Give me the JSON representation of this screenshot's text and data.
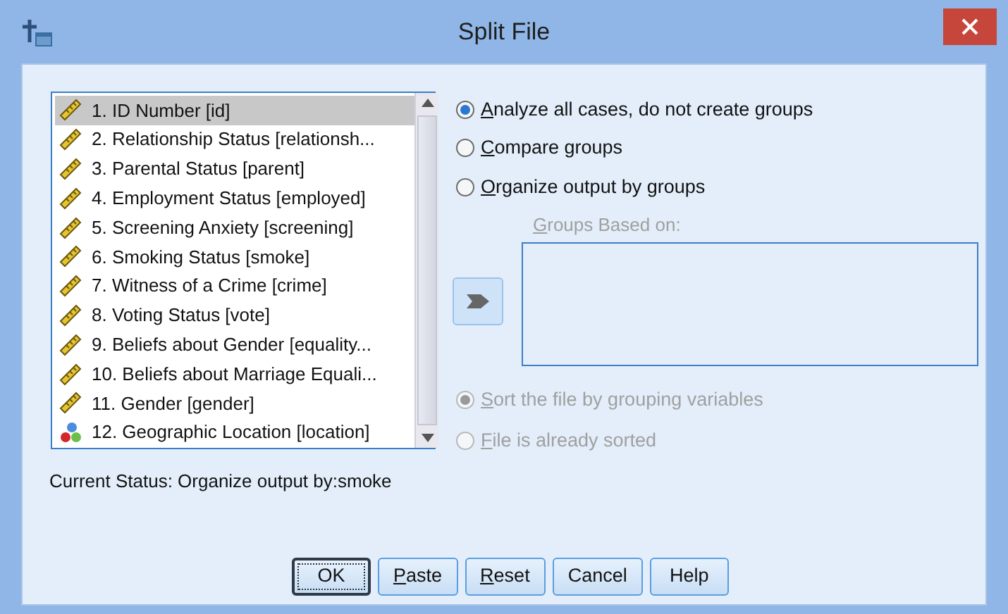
{
  "window": {
    "title": "Split File"
  },
  "variables": [
    {
      "label": "1. ID Number [id]",
      "kind": "scale",
      "selected": true
    },
    {
      "label": "2. Relationship Status [relationsh...",
      "kind": "scale",
      "selected": false
    },
    {
      "label": "3. Parental Status [parent]",
      "kind": "scale",
      "selected": false
    },
    {
      "label": "4. Employment Status [employed]",
      "kind": "scale",
      "selected": false
    },
    {
      "label": "5. Screening Anxiety [screening]",
      "kind": "scale",
      "selected": false
    },
    {
      "label": "6. Smoking Status [smoke]",
      "kind": "scale",
      "selected": false
    },
    {
      "label": "7. Witness of a Crime [crime]",
      "kind": "scale",
      "selected": false
    },
    {
      "label": "8. Voting Status [vote]",
      "kind": "scale",
      "selected": false
    },
    {
      "label": "9. Beliefs about Gender [equality...",
      "kind": "scale",
      "selected": false
    },
    {
      "label": "10. Beliefs about Marriage Equali...",
      "kind": "scale",
      "selected": false
    },
    {
      "label": "11. Gender [gender]",
      "kind": "scale",
      "selected": false
    },
    {
      "label": "12. Geographic Location [location]",
      "kind": "nominal",
      "selected": false
    }
  ],
  "mode_options": [
    {
      "label": "Analyze all cases, do not create groups",
      "selected": true,
      "mnemonic": true
    },
    {
      "label": "Compare groups",
      "selected": false,
      "mnemonic": true
    },
    {
      "label": "Organize output by groups",
      "selected": false,
      "mnemonic": true
    }
  ],
  "groups_field": {
    "label": "Groups Based on:",
    "disabled": true,
    "mnemonic": true
  },
  "sort_options": [
    {
      "label": "Sort the file by grouping variables",
      "selected": true,
      "disabled": true,
      "mnemonic": true
    },
    {
      "label": "File is already sorted",
      "selected": false,
      "disabled": true,
      "mnemonic": true
    }
  ],
  "status": "Current Status: Organize output by:smoke",
  "buttons": [
    {
      "label": "OK",
      "default": true,
      "mnemonic": false
    },
    {
      "label": "Paste",
      "default": false,
      "mnemonic": true
    },
    {
      "label": "Reset",
      "default": false,
      "mnemonic": true
    },
    {
      "label": "Cancel",
      "default": false,
      "mnemonic": false
    },
    {
      "label": "Help",
      "default": false,
      "mnemonic": false
    }
  ]
}
